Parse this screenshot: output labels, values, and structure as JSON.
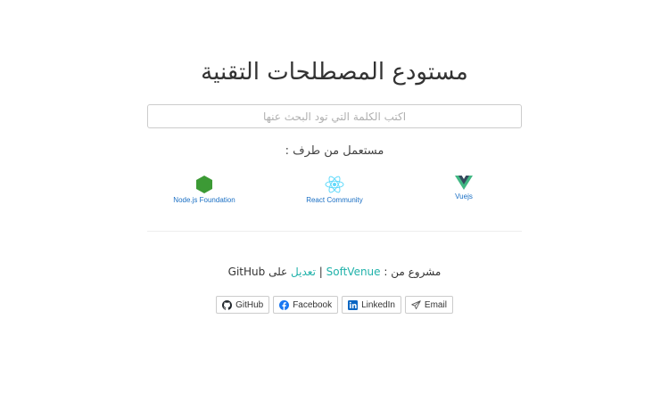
{
  "title": "مستودع المصطلحات التقنية",
  "search": {
    "placeholder": "اكتب الكلمة التي تود البحث عنها",
    "value": ""
  },
  "used_by": {
    "label": "مستعمل من طرف :",
    "sponsors": [
      {
        "name": "Node.js Foundation",
        "icon": "nodejs-icon"
      },
      {
        "name": "React Community",
        "icon": "react-icon"
      },
      {
        "name": "Vuejs",
        "icon": "vuejs-icon"
      }
    ]
  },
  "credit": {
    "prefix": "مشروع من :",
    "author": "SoftVenue",
    "separator": "|",
    "edit_link": "تعديل",
    "on": "على",
    "platform": "GitHub"
  },
  "social": [
    {
      "label": "GitHub",
      "icon": "github-icon"
    },
    {
      "label": "Facebook",
      "icon": "facebook-icon"
    },
    {
      "label": "LinkedIn",
      "icon": "linkedin-icon"
    },
    {
      "label": "Email",
      "icon": "paper-plane-icon"
    }
  ],
  "colors": {
    "link": "#20b2aa",
    "sponsor_label": "#1a6fc4",
    "node_green": "#3c9a35",
    "react_blue": "#61dafb",
    "vue_green": "#41b883",
    "vue_dark": "#35495e",
    "facebook_blue": "#1877f2",
    "linkedin_blue": "#0a66c2"
  }
}
